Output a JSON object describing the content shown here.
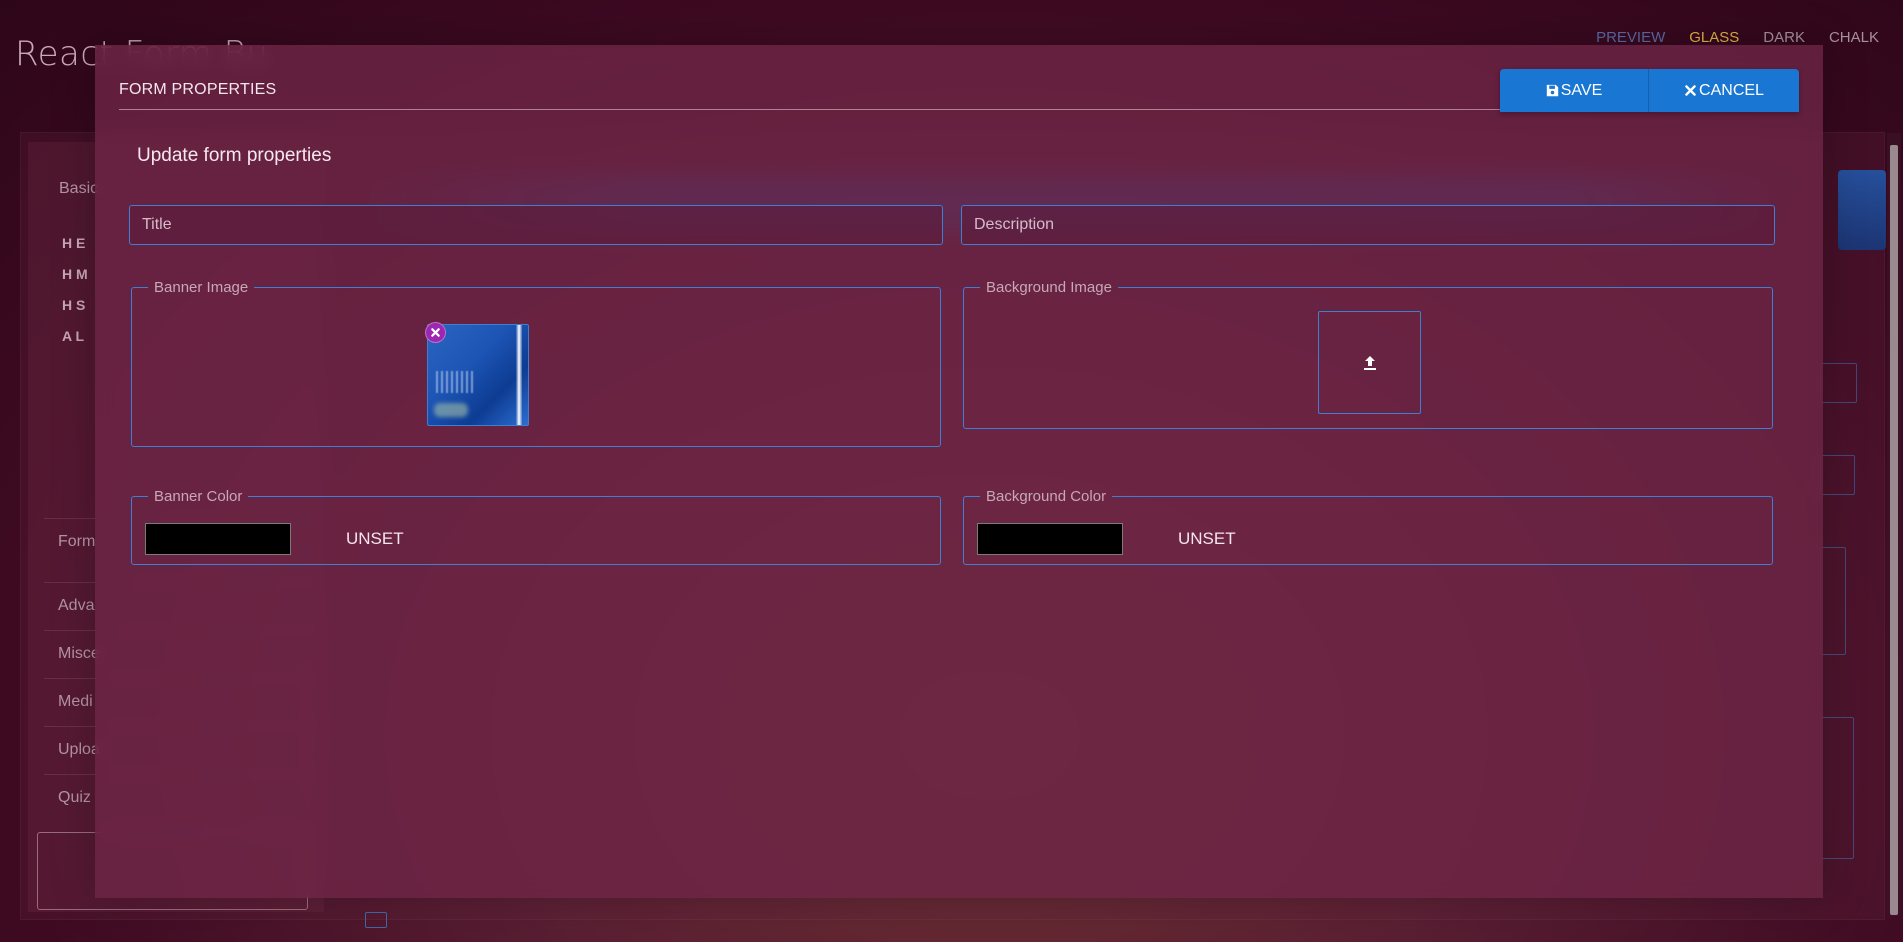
{
  "app": {
    "title": "React Form Bu",
    "themes": [
      "PREVIEW",
      "GLASS",
      "DARK",
      "CHALK"
    ]
  },
  "background": {
    "sidebar_heading": "Basic",
    "tools": [
      "H E",
      "H M",
      "H S",
      "A L"
    ],
    "categories": [
      "Form",
      "Adva",
      "Misce",
      "Medi",
      "Uploa",
      "Quiz"
    ]
  },
  "modal": {
    "title": "FORM PROPERTIES",
    "save_label": "SAVE",
    "cancel_label": "CANCEL",
    "subtitle": "Update form properties",
    "title_placeholder": "Title",
    "title_value": "",
    "description_placeholder": "Description",
    "description_value": "",
    "banner_image_label": "Banner Image",
    "background_image_label": "Background Image",
    "banner_color_label": "Banner Color",
    "background_color_label": "Background Color",
    "unset_label": "UNSET",
    "banner_color_value": "#000000",
    "background_color_value": "#000000"
  },
  "colors": {
    "primary": "#1976d2",
    "accent_purple": "#9c27b0",
    "border_blue": "#3d7fd0",
    "theme_glass_active": "#e0b347"
  },
  "icons": {
    "save": "floppy-disk-icon",
    "cancel": "x-icon",
    "remove": "close-circle-icon",
    "upload": "upload-icon"
  }
}
